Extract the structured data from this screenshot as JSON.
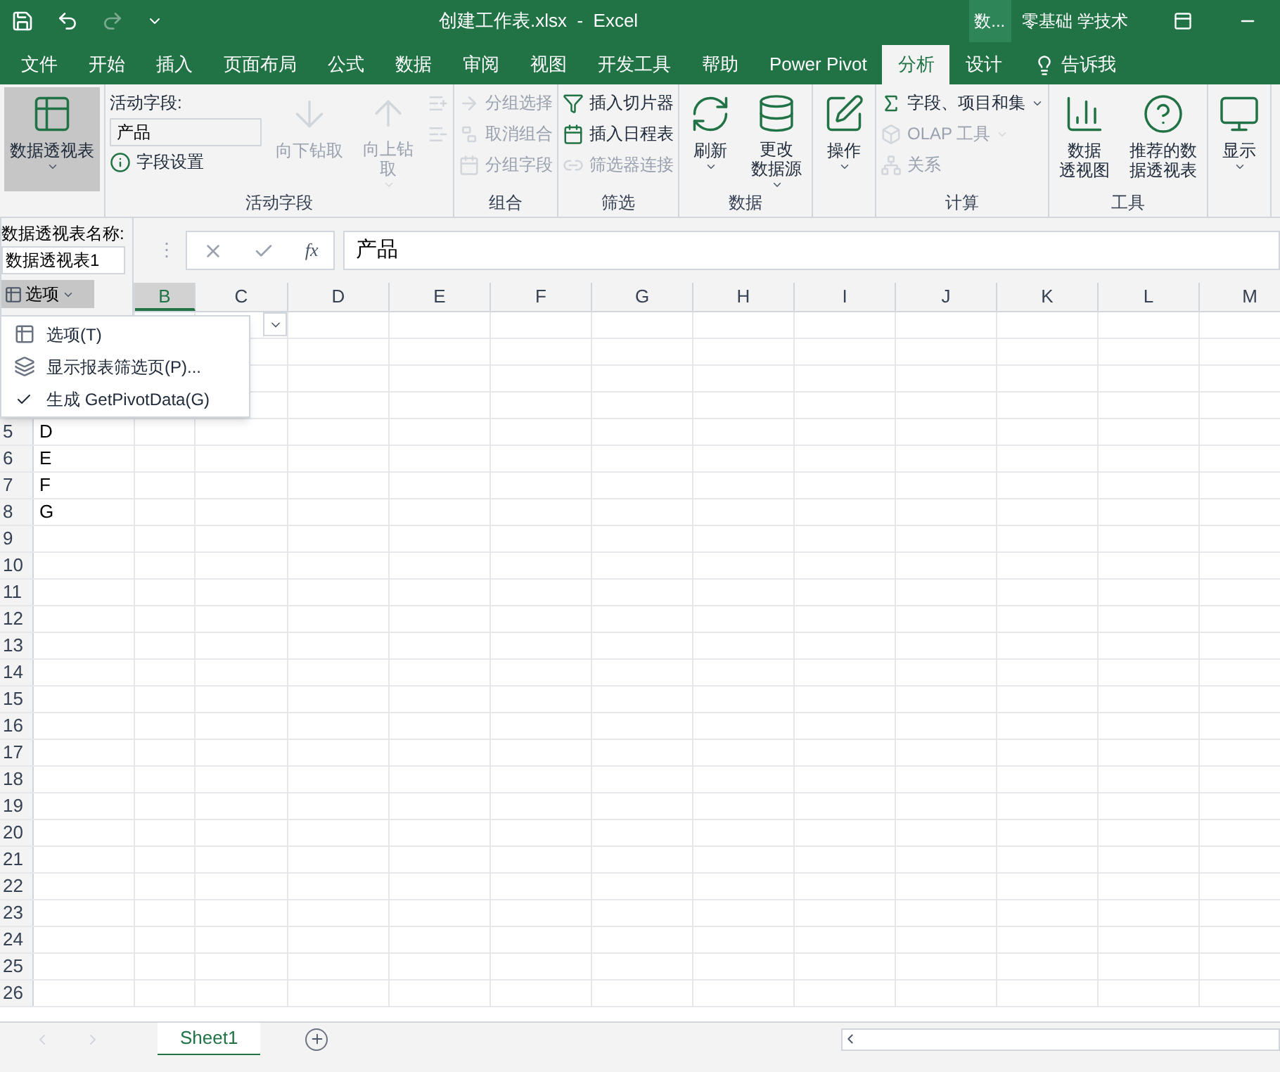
{
  "title_bar": {
    "title": "创建工作表.xlsx  -  Excel",
    "search_box": "数...",
    "account": "零基础 学技术",
    "redo_disabled": true
  },
  "tabs": [
    {
      "label": "文件",
      "selected": false
    },
    {
      "label": "开始",
      "selected": false
    },
    {
      "label": "插入",
      "selected": false
    },
    {
      "label": "页面布局",
      "selected": false
    },
    {
      "label": "公式",
      "selected": false
    },
    {
      "label": "数据",
      "selected": false
    },
    {
      "label": "审阅",
      "selected": false
    },
    {
      "label": "视图",
      "selected": false
    },
    {
      "label": "开发工具",
      "selected": false
    },
    {
      "label": "帮助",
      "selected": false
    },
    {
      "label": "Power Pivot",
      "selected": false
    },
    {
      "label": "分析",
      "selected": true
    },
    {
      "label": "设计",
      "selected": false
    }
  ],
  "tell_me": "告诉我",
  "ribbon": [
    {
      "columns": [
        [
          {
            "kind": "large",
            "label": "数据透视表",
            "dropdown": true,
            "expanded": true,
            "disabled": false
          }
        ]
      ]
    },
    {
      "label": "活动字段",
      "columns": [
        [
          {
            "kind": "text",
            "label": "活动字段:"
          },
          {
            "kind": "input",
            "value": "产品"
          },
          {
            "kind": "small",
            "label": "字段设置",
            "disabled": false
          }
        ],
        [
          {
            "kind": "large",
            "label": "向下钻取",
            "disabled": true
          }
        ],
        [
          {
            "kind": "large",
            "lines": [
              "向上钻",
              "取"
            ],
            "dropdown": true,
            "disabled": true
          }
        ],
        [
          {
            "kind": "icon",
            "disabled": true
          },
          {
            "kind": "icon",
            "disabled": true
          }
        ]
      ]
    },
    {
      "label": "组合",
      "columns": [
        [
          {
            "kind": "small",
            "label": "分组选择",
            "disabled": true
          },
          {
            "kind": "small",
            "label": "取消组合",
            "disabled": true
          },
          {
            "kind": "small",
            "label": "分组字段",
            "disabled": true
          }
        ]
      ]
    },
    {
      "label": "筛选",
      "columns": [
        [
          {
            "kind": "small",
            "label": "插入切片器",
            "disabled": false
          },
          {
            "kind": "small",
            "label": "插入日程表",
            "disabled": false
          },
          {
            "kind": "small",
            "label": "筛选器连接",
            "disabled": true
          }
        ]
      ]
    },
    {
      "label": "数据",
      "columns": [
        [
          {
            "kind": "large",
            "label": "刷新",
            "dropdown": true,
            "disabled": false
          }
        ],
        [
          {
            "kind": "large",
            "lines": [
              "更改",
              "数据源"
            ],
            "dropdown": true,
            "disabled": false
          }
        ]
      ]
    },
    {
      "columns": [
        [
          {
            "kind": "large",
            "label": "操作",
            "dropdown": true,
            "disabled": false
          }
        ]
      ]
    },
    {
      "label": "计算",
      "columns": [
        [
          {
            "kind": "small",
            "label": "字段、项目和集",
            "dropdown": true,
            "disabled": false
          },
          {
            "kind": "small",
            "label": "OLAP 工具",
            "dropdown": true,
            "disabled": true
          },
          {
            "kind": "small",
            "label": "关系",
            "disabled": true
          }
        ]
      ]
    },
    {
      "label": "工具",
      "columns": [
        [
          {
            "kind": "large",
            "lines": [
              "数据",
              "透视图"
            ],
            "disabled": false
          }
        ],
        [
          {
            "kind": "large",
            "lines": [
              "推荐的数",
              "据透视表"
            ],
            "disabled": false
          }
        ]
      ]
    },
    {
      "columns": [
        [
          {
            "kind": "large",
            "label": "显示",
            "dropdown": true,
            "disabled": false
          }
        ]
      ]
    }
  ],
  "pivot_panel": {
    "name_label": "数据透视表名称:",
    "name_value": "数据透视表1",
    "options_button": "选项"
  },
  "options_menu": [
    {
      "label": "选项(T)",
      "checked": false
    },
    {
      "label": "显示报表筛选页(P)...",
      "checked": false
    },
    {
      "label": "生成 GetPivotData(G)",
      "checked": true
    }
  ],
  "formula_bar": {
    "separator": "⋮",
    "function_label": "fx",
    "content": "产品"
  },
  "columns": [
    {
      "label": "B",
      "selected": true
    },
    {
      "label": "C",
      "selected": false
    },
    {
      "label": "D",
      "selected": false
    },
    {
      "label": "E",
      "selected": false
    },
    {
      "label": "F",
      "selected": false
    },
    {
      "label": "G",
      "selected": false
    },
    {
      "label": "H",
      "selected": false
    },
    {
      "label": "I",
      "selected": false
    },
    {
      "label": "J",
      "selected": false
    },
    {
      "label": "K",
      "selected": false
    },
    {
      "label": "L",
      "selected": false
    },
    {
      "label": "M",
      "selected": false
    }
  ],
  "rows": [
    {
      "filter_button": true
    },
    {},
    {},
    {},
    {
      "header": "5",
      "a": "D"
    },
    {
      "header": "6",
      "a": "E"
    },
    {
      "header": "7",
      "a": "F"
    },
    {
      "header": "8",
      "a": "G"
    },
    {
      "header": "9"
    },
    {
      "header": "10"
    },
    {
      "header": "11"
    },
    {
      "header": "12"
    },
    {
      "header": "13"
    },
    {
      "header": "14"
    },
    {
      "header": "15"
    },
    {
      "header": "16"
    },
    {
      "header": "17"
    },
    {
      "header": "18"
    },
    {
      "header": "19"
    },
    {
      "header": "20"
    },
    {
      "header": "21"
    },
    {
      "header": "22"
    },
    {
      "header": "23"
    },
    {
      "header": "24"
    },
    {
      "header": "25"
    },
    {
      "header": "26"
    }
  ],
  "sheets": [
    {
      "label": "Sheet1",
      "selected": true
    }
  ]
}
